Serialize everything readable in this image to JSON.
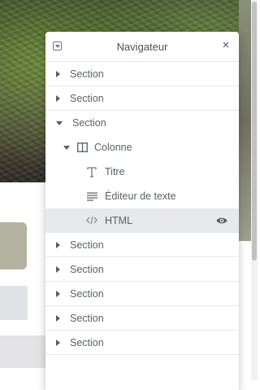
{
  "navigator": {
    "title": "Navigateur",
    "rows": [
      {
        "label": "Section",
        "level": 0,
        "expanded": false,
        "icon": "caret-right-icon"
      },
      {
        "label": "Section",
        "level": 0,
        "expanded": false,
        "icon": "caret-right-icon"
      },
      {
        "label": "Section",
        "level": 0,
        "expanded": true,
        "icon": "caret-down-icon"
      },
      {
        "label": "Colonne",
        "level": 1,
        "expanded": true,
        "icon": "column-icon"
      },
      {
        "label": "Titre",
        "level": 2,
        "icon": "heading-icon"
      },
      {
        "label": "Éditeur de texte",
        "level": 2,
        "icon": "text-editor-icon"
      },
      {
        "label": "HTML",
        "level": 2,
        "icon": "code-icon",
        "selected": true,
        "visibility_icon": "eye-icon"
      },
      {
        "label": "Section",
        "level": 0,
        "expanded": false,
        "icon": "caret-right-icon"
      },
      {
        "label": "Section",
        "level": 0,
        "expanded": false,
        "icon": "caret-right-icon"
      },
      {
        "label": "Section",
        "level": 0,
        "expanded": false,
        "icon": "caret-right-icon"
      },
      {
        "label": "Section",
        "level": 0,
        "expanded": false,
        "icon": "caret-right-icon"
      },
      {
        "label": "Section",
        "level": 0,
        "expanded": false,
        "icon": "caret-right-icon"
      }
    ]
  },
  "colors": {
    "selected_row": "#e6e8eb",
    "text": "#5b6168",
    "divider": "#e6e6e6"
  }
}
